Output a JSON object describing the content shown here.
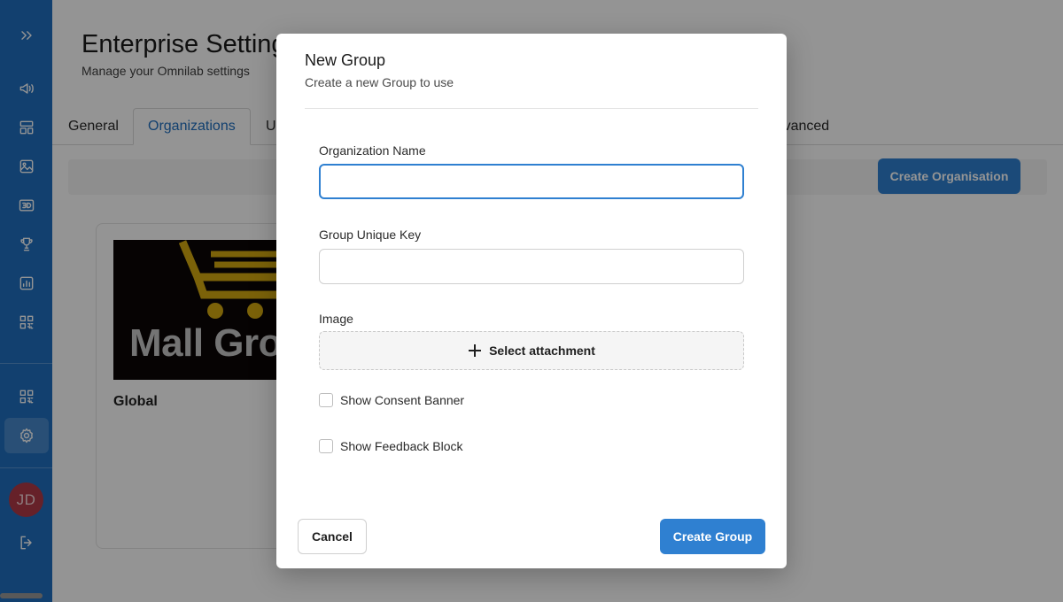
{
  "colors": {
    "sidebar": "#1f6fc0",
    "primary": "#2f80d1",
    "avatar": "#b03a48",
    "overlay": "rgba(0,0,0,0.42)"
  },
  "sidebar": {
    "items": [
      {
        "icon": "double-chevron-right-icon"
      },
      {
        "icon": "megaphone-icon"
      },
      {
        "icon": "layout-icon"
      },
      {
        "icon": "image-icon"
      },
      {
        "icon": "3d-icon"
      },
      {
        "icon": "trophy-icon"
      },
      {
        "icon": "chart-icon"
      },
      {
        "icon": "qr-code-icon"
      },
      {
        "icon": "qr-code-icon"
      },
      {
        "icon": "gear-icon",
        "active": true
      },
      {
        "icon": "logout-icon"
      }
    ],
    "avatar_initials": "JD"
  },
  "page": {
    "title": "Enterprise Settings",
    "subtitle": "Manage your Omnilab settings",
    "tabs": [
      {
        "label": "General"
      },
      {
        "label": "Organizations",
        "active": true
      },
      {
        "label": "Users"
      },
      {
        "label": "Advanced"
      }
    ],
    "create_organisation_label": "Create Organisation",
    "organizations": [
      {
        "name": "Global",
        "logo_text": "Mall Group"
      }
    ]
  },
  "modal": {
    "title": "New Group",
    "subtitle": "Create a new Group to use",
    "org_name_label": "Organization Name",
    "org_name_value": "",
    "group_key_label": "Group Unique Key",
    "group_key_value": "",
    "image_label": "Image",
    "attach_label": "Select attachment",
    "consent_label": "Show Consent Banner",
    "consent_checked": false,
    "feedback_label": "Show Feedback Block",
    "feedback_checked": false,
    "cancel_label": "Cancel",
    "create_label": "Create Group"
  }
}
